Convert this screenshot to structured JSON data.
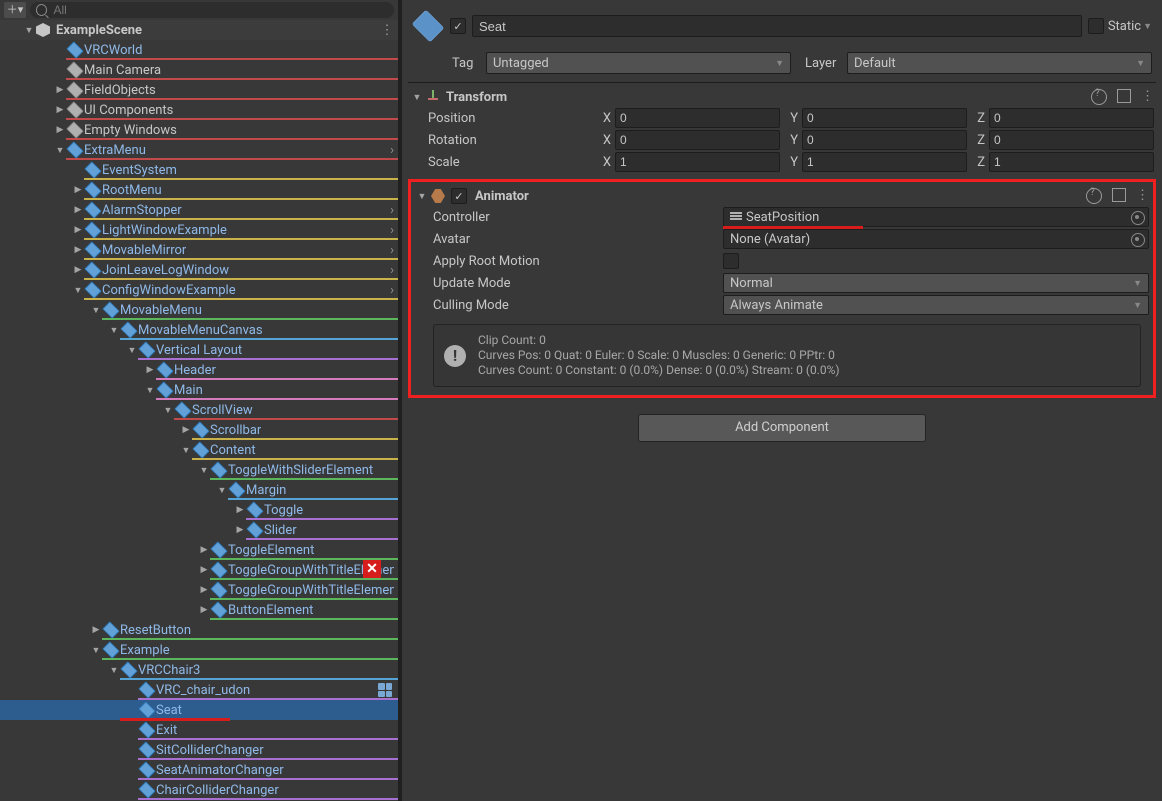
{
  "search": {
    "placeholder": "All"
  },
  "scene": {
    "name": "ExampleScene"
  },
  "rows": [
    {
      "indent": 1,
      "fold": "",
      "icon": "prefab",
      "label": "VRCWorld",
      "prefab": true,
      "bar": "#c24a4a",
      "chevron": false
    },
    {
      "indent": 1,
      "fold": "",
      "icon": "go",
      "label": "Main Camera",
      "prefab": false,
      "bar": "#c24a4a",
      "chevron": false
    },
    {
      "indent": 1,
      "fold": "right",
      "icon": "go",
      "label": "FieldObjects",
      "prefab": false,
      "bar": "#c24a4a",
      "chevron": false
    },
    {
      "indent": 1,
      "fold": "right",
      "icon": "go",
      "label": "UI Components",
      "prefab": false,
      "bar": "#c24a4a",
      "chevron": false
    },
    {
      "indent": 1,
      "fold": "right",
      "icon": "go",
      "label": "Empty Windows",
      "prefab": false,
      "bar": "#c24a4a",
      "chevron": false
    },
    {
      "indent": 1,
      "fold": "down",
      "icon": "prefab",
      "label": "ExtraMenu",
      "prefab": true,
      "bar": "#c24a4a",
      "chevron": true
    },
    {
      "indent": 2,
      "fold": "",
      "icon": "prefab",
      "label": "EventSystem",
      "prefab": true,
      "bar": "#c9b24a",
      "chevron": false
    },
    {
      "indent": 2,
      "fold": "right",
      "icon": "prefab",
      "label": "RootMenu",
      "prefab": true,
      "bar": "#c9b24a",
      "chevron": false
    },
    {
      "indent": 2,
      "fold": "right",
      "icon": "prefab",
      "label": "AlarmStopper",
      "prefab": true,
      "bar": "#c9b24a",
      "chevron": true
    },
    {
      "indent": 2,
      "fold": "right",
      "icon": "prefab",
      "label": "LightWindowExample",
      "prefab": true,
      "bar": "#c9b24a",
      "chevron": true
    },
    {
      "indent": 2,
      "fold": "right",
      "icon": "prefab",
      "label": "MovableMirror",
      "prefab": true,
      "bar": "#c9b24a",
      "chevron": true
    },
    {
      "indent": 2,
      "fold": "right",
      "icon": "prefab",
      "label": "JoinLeaveLogWindow",
      "prefab": true,
      "bar": "#c9b24a",
      "chevron": true
    },
    {
      "indent": 2,
      "fold": "down",
      "icon": "prefab",
      "label": "ConfigWindowExample",
      "prefab": true,
      "bar": "#c9b24a",
      "chevron": true
    },
    {
      "indent": 3,
      "fold": "down",
      "icon": "prefab",
      "label": "MovableMenu",
      "prefab": true,
      "bar": "#5cb65c",
      "chevron": false
    },
    {
      "indent": 4,
      "fold": "down",
      "icon": "prefab",
      "label": "MovableMenuCanvas",
      "prefab": true,
      "bar": "#56a3d6",
      "chevron": false
    },
    {
      "indent": 5,
      "fold": "down",
      "icon": "prefab",
      "label": "Vertical Layout",
      "prefab": true,
      "bar": "#a871d1",
      "chevron": false
    },
    {
      "indent": 6,
      "fold": "right",
      "icon": "prefab",
      "label": "Header",
      "prefab": true,
      "bar": "#d47bbd",
      "chevron": false
    },
    {
      "indent": 6,
      "fold": "down",
      "icon": "prefab",
      "label": "Main",
      "prefab": true,
      "bar": "#d47bbd",
      "chevron": false
    },
    {
      "indent": 7,
      "fold": "down",
      "icon": "prefab",
      "label": "ScrollView",
      "prefab": true,
      "bar": "#c24a4a",
      "chevron": false
    },
    {
      "indent": 8,
      "fold": "right",
      "icon": "prefab",
      "label": "Scrollbar",
      "prefab": true,
      "bar": "#c9b24a",
      "chevron": false
    },
    {
      "indent": 8,
      "fold": "down",
      "icon": "prefab",
      "label": "Content",
      "prefab": true,
      "bar": "#c9b24a",
      "chevron": false
    },
    {
      "indent": 9,
      "fold": "down",
      "icon": "prefab",
      "label": "ToggleWithSliderElement",
      "prefab": true,
      "bar": "#5cb65c",
      "chevron": false
    },
    {
      "indent": 10,
      "fold": "down",
      "icon": "prefab",
      "label": "Margin",
      "prefab": true,
      "bar": "#56a3d6",
      "chevron": false
    },
    {
      "indent": 11,
      "fold": "right",
      "icon": "prefab",
      "label": "Toggle",
      "prefab": true,
      "bar": "#a871d1",
      "chevron": false
    },
    {
      "indent": 11,
      "fold": "right",
      "icon": "prefab",
      "label": "Slider",
      "prefab": true,
      "bar": "#a871d1",
      "chevron": false
    },
    {
      "indent": 9,
      "fold": "right",
      "icon": "prefab",
      "label": "ToggleElement",
      "prefab": true,
      "bar": "#5cb65c",
      "chevron": false
    },
    {
      "indent": 9,
      "fold": "right",
      "icon": "prefab",
      "label": "ToggleGroupWithTitleElement",
      "prefab": true,
      "bar": "#5cb65c",
      "chevron": false
    },
    {
      "indent": 9,
      "fold": "right",
      "icon": "prefab",
      "label": "ToggleGroupWithTitleElement",
      "prefab": true,
      "bar": "#5cb65c",
      "chevron": false
    },
    {
      "indent": 9,
      "fold": "right",
      "icon": "prefab",
      "label": "ButtonElement",
      "prefab": true,
      "bar": "#5cb65c",
      "chevron": false
    },
    {
      "indent": 3,
      "fold": "right",
      "icon": "prefab",
      "label": "ResetButton",
      "prefab": true,
      "bar": "#5cb65c",
      "chevron": false
    },
    {
      "indent": 3,
      "fold": "down",
      "icon": "prefab",
      "label": "Example",
      "prefab": true,
      "bar": "#5cb65c",
      "chevron": false
    },
    {
      "indent": 4,
      "fold": "down",
      "icon": "prefab",
      "label": "VRCChair3",
      "prefab": true,
      "bar": "#56a3d6",
      "chevron": false
    },
    {
      "indent": 5,
      "fold": "",
      "icon": "prefab",
      "label": "VRC_chair_udon",
      "prefab": true,
      "bar": "#a871d1",
      "chevron": false,
      "pool": true
    },
    {
      "indent": 5,
      "fold": "",
      "icon": "prefab",
      "label": "Seat",
      "prefab": true,
      "bar": "",
      "chevron": false,
      "selected": true,
      "underline": true
    },
    {
      "indent": 5,
      "fold": "",
      "icon": "prefab",
      "label": "Exit",
      "prefab": true,
      "bar": "#a871d1",
      "chevron": false
    },
    {
      "indent": 5,
      "fold": "",
      "icon": "prefab",
      "label": "SitColliderChanger",
      "prefab": true,
      "bar": "#a871d1",
      "chevron": false
    },
    {
      "indent": 5,
      "fold": "",
      "icon": "prefab",
      "label": "SeatAnimatorChanger",
      "prefab": true,
      "bar": "#a871d1",
      "chevron": false
    },
    {
      "indent": 5,
      "fold": "",
      "icon": "prefab",
      "label": "ChairColliderChanger",
      "prefab": true,
      "bar": "#a871d1",
      "chevron": false
    }
  ],
  "inspector": {
    "active": true,
    "name": "Seat",
    "static_label": "Static",
    "tag_label": "Tag",
    "layer_label": "Layer",
    "tag": "Untagged",
    "layer": "Default",
    "transform": {
      "title": "Transform",
      "position_label": "Position",
      "rotation_label": "Rotation",
      "scale_label": "Scale",
      "pos": {
        "x": "0",
        "y": "0",
        "z": "0"
      },
      "rot": {
        "x": "0",
        "y": "0",
        "z": "0"
      },
      "scale": {
        "x": "1",
        "y": "1",
        "z": "1"
      }
    },
    "animator": {
      "title": "Animator",
      "controller_label": "Controller",
      "avatar_label": "Avatar",
      "apply_root_motion_label": "Apply Root Motion",
      "update_mode_label": "Update Mode",
      "culling_mode_label": "Culling Mode",
      "controller": "SeatPosition",
      "avatar": "None (Avatar)",
      "apply_root_motion": false,
      "update_mode": "Normal",
      "culling_mode": "Always Animate",
      "info_line1": "Clip Count: 0",
      "info_line2": "Curves Pos: 0 Quat: 0 Euler: 0 Scale: 0 Muscles: 0 Generic: 0 PPtr: 0",
      "info_line3": "Curves Count: 0 Constant: 0 (0.0%) Dense: 0 (0.0%) Stream: 0 (0.0%)"
    },
    "add_component": "Add Component"
  }
}
